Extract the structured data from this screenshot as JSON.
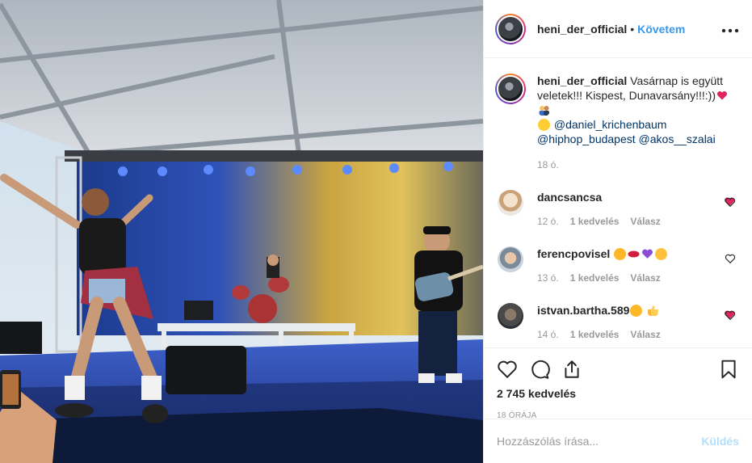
{
  "post": {
    "username": "heni_der_official",
    "separator": "•",
    "follow_label": "Követem",
    "more_label": "•••"
  },
  "caption": {
    "username": "heni_der_official",
    "text": "Vasárnap is együtt veletek!!! Kispest, Dunavarsány!!!:))",
    "mentions": [
      "@daniel_krichenbaum",
      "@hiphop_budapest",
      "@akos__szalai"
    ],
    "time": "18 ó."
  },
  "comments": [
    {
      "username": "dancsancsa",
      "time": "12 ó.",
      "likes": "1 kedvelés",
      "reply": "Válasz"
    },
    {
      "username": "ferencpovisel",
      "time": "13 ó.",
      "likes": "1 kedvelés",
      "reply": "Válasz"
    },
    {
      "username": "istvan.bartha.589",
      "time": "14 ó.",
      "likes": "1 kedvelés",
      "reply": "Válasz"
    }
  ],
  "actions": {
    "likes_count": "2 745 kedvelés",
    "post_time": "18 órája"
  },
  "add_comment": {
    "placeholder": "Hozzászólás írása...",
    "post_label": "Küldés"
  },
  "icons": {
    "like": "heart-icon",
    "comment": "comment-bubble-icon",
    "share": "share-icon",
    "save": "bookmark-icon",
    "options": "more-options-icon"
  },
  "colors": {
    "link": "#3897f0",
    "mention": "#003569",
    "muted": "#999999",
    "post_disabled": "#b2dffc"
  }
}
